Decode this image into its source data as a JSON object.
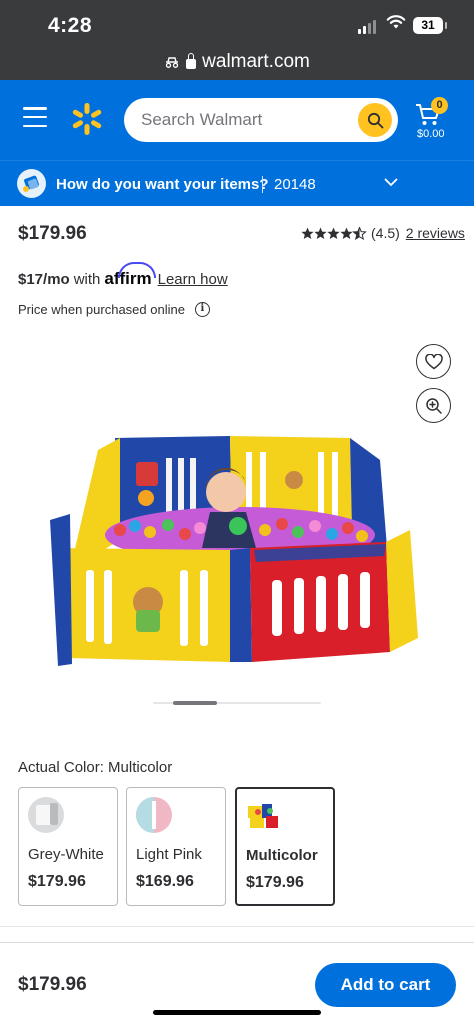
{
  "status_bar": {
    "time": "4:28",
    "battery": "31",
    "url": "walmart.com"
  },
  "header": {
    "search_placeholder": "Search Walmart",
    "cart_count": "0",
    "cart_total": "$0.00",
    "accent": "#0071dc",
    "yellow": "#ffc220"
  },
  "fulfillment": {
    "question": "How do you want your items?",
    "zip": "20148"
  },
  "product": {
    "price": "$179.96",
    "rating_text": "(4.5)",
    "rating_value": 4.5,
    "reviews": "2 reviews",
    "affirm_monthly": "$17/mo",
    "affirm_with": "with",
    "affirm_brand": "affirm",
    "affirm_learn": "Learn how",
    "price_note": "Price when purchased online",
    "actual_color_label": "Actual Color: Multicolor"
  },
  "variants": [
    {
      "name": "Grey-White",
      "price": "$179.96",
      "selected": false
    },
    {
      "name": "Light Pink",
      "price": "$169.96",
      "selected": false
    },
    {
      "name": "Multicolor",
      "price": "$179.96",
      "selected": true
    }
  ],
  "carousel": {
    "slides": 3,
    "active": 1
  },
  "sticky": {
    "price": "$179.96",
    "add_to_cart": "Add to cart"
  }
}
